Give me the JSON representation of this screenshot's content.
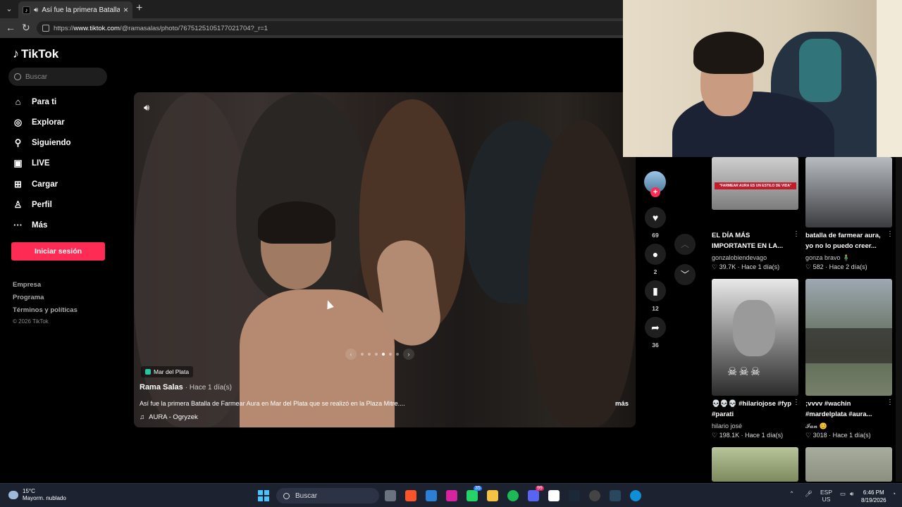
{
  "browser": {
    "tab_title": "Así fue la primera Batalla de F",
    "url_prefix": "https://",
    "url_host": "www.tiktok.com",
    "url_path": "/@ramasalas/photo/7675125105177021704?_r=1"
  },
  "sidebar": {
    "logo": "TikTok",
    "search_placeholder": "Buscar",
    "nav": [
      {
        "label": "Para ti",
        "icon": "home-icon"
      },
      {
        "label": "Explorar",
        "icon": "compass-icon"
      },
      {
        "label": "Siguiendo",
        "icon": "user-follow-icon"
      },
      {
        "label": "LIVE",
        "icon": "live-icon"
      },
      {
        "label": "Cargar",
        "icon": "upload-icon"
      },
      {
        "label": "Perfil",
        "icon": "profile-icon"
      },
      {
        "label": "Más",
        "icon": "more-icon"
      }
    ],
    "login_button": "Iniciar sesión",
    "footer": {
      "company": "Empresa",
      "program": "Programa",
      "terms": "Términos y políticas",
      "copyright": "© 2026 TikTok"
    }
  },
  "post": {
    "location": "Mar del Plata",
    "author": "Rama Salas",
    "time_ago": "· Hace 1 día(s)",
    "caption": "Así fue la primera Batalla de Farmear Aura en Mar del Plata que se realizó en la Plaza Mitre....",
    "more": "más",
    "music": "AURA - Ogryzek",
    "slides_total": 6,
    "slide_current": 4,
    "likes": "69",
    "comments": "2",
    "saves": "12",
    "shares": "36"
  },
  "recommendations": [
    {
      "title": "EL DÍA MÁS IMPORTANTE EN LA...",
      "user": "gonzalobiendevago",
      "likes": "39.7K",
      "ago": "Hace 1 día(s)",
      "overlay": "\"FARMEAR AURA ES UN ESTILO DE VIDA\""
    },
    {
      "title": "batalla de farmear aura, yo no lo puedo creer...",
      "user": "gonza bravo 🧍‍♂️",
      "likes": "582",
      "ago": "Hace 2 día(s)"
    },
    {
      "title": "💀💀💀 #hilariojose #fyp #parati",
      "user": "hilario josé",
      "likes": "198.1K",
      "ago": "Hace 1 día(s)"
    },
    {
      "title": ";vvvv #wachin #mardelplata #aura...",
      "user": "𝓘𝓪𝓷 😊",
      "likes": "3018",
      "ago": "Hace 1 día(s)"
    }
  ],
  "taskbar": {
    "temp": "15°C",
    "weather": "Mayorm. nublado",
    "search": "Buscar",
    "lang1": "ESP",
    "lang2": "US",
    "time": "6:46 PM",
    "date": "8/19/2026",
    "badge_whatsapp": "35",
    "badge_discord": "99"
  },
  "colors": {
    "brand": "#fe2c55",
    "background": "#000000",
    "taskbar": "#1c2230"
  }
}
